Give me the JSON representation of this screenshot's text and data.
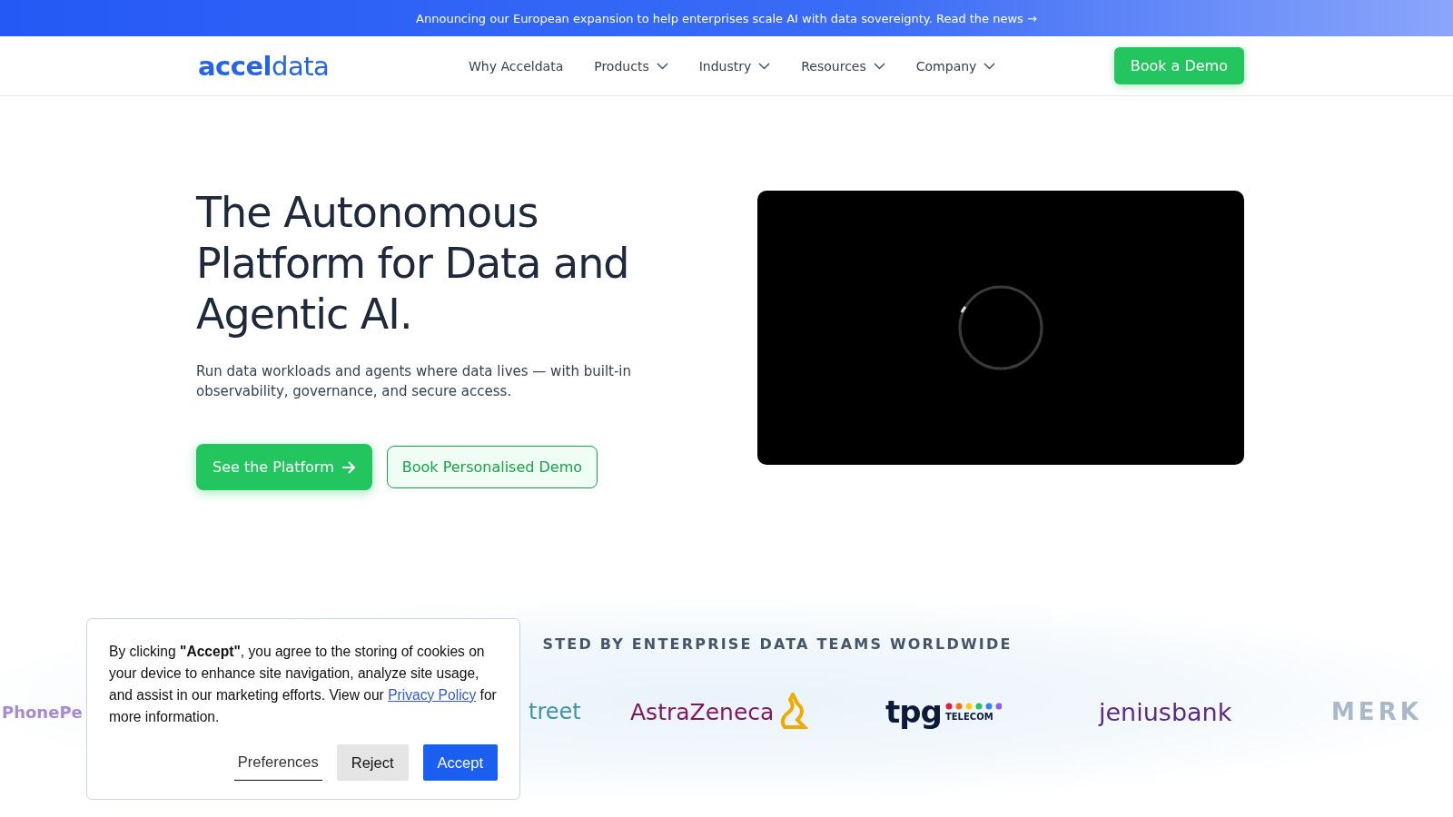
{
  "announcement": {
    "text": "Announcing our European expansion to help enterprises scale AI with data sovereignty. Read the news →"
  },
  "header": {
    "logo": "**accel**data",
    "nav": [
      {
        "label": "Why Acceldata",
        "dropdown": false
      },
      {
        "label": "Products",
        "dropdown": true
      },
      {
        "label": "Industry",
        "dropdown": true
      },
      {
        "label": "Resources",
        "dropdown": true
      },
      {
        "label": "Company",
        "dropdown": true
      }
    ],
    "cta": "Book a Demo"
  },
  "hero": {
    "title": "The Autonomous Platform for Data and Agentic AI.",
    "subtitle": "Run data workloads and agents where data lives — with built-in observability, governance, and secure access.",
    "primary_button": "See the Platform",
    "secondary_button": "Book Personalised Demo",
    "video": {
      "loading": true
    }
  },
  "trusted": {
    "heading": "STED BY ENTERPRISE DATA TEAMS WORLDWIDE",
    "logos": [
      {
        "kind": "phonepe",
        "name": "PhonePe"
      },
      {
        "kind": "street",
        "name": "treet"
      },
      {
        "kind": "astrazeneca",
        "name": "AstraZeneca"
      },
      {
        "kind": "tpg",
        "name": "tpg",
        "sub": "TELECOM"
      },
      {
        "kind": "jenius",
        "name": "jeniusbank"
      },
      {
        "kind": "merkle",
        "name": "MERK"
      }
    ]
  },
  "cookie_banner": {
    "text_before": "By clicking **\"Accept\"**, you agree to the storing of cookies on your device to enhance site navigation, analyze site usage, and assist in our marketing efforts. View our",
    "link": "Privacy Policy",
    "text_after": "for more information.",
    "buttons": [
      {
        "label": "Preferences",
        "kind": "link"
      },
      {
        "label": "Reject",
        "kind": "secondary"
      },
      {
        "label": "Accept",
        "kind": "primary"
      }
    ]
  }
}
